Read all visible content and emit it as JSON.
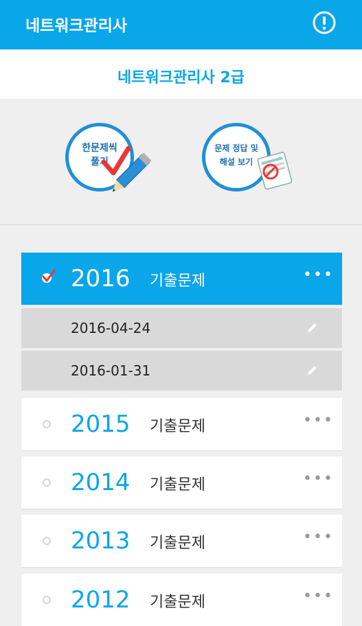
{
  "app_bar": {
    "title": "네트워크관리사"
  },
  "subheader": {
    "title": "네트워크관리사 2급"
  },
  "actions": {
    "study": {
      "text_line1": "한문제씩",
      "text_line2": "풀기"
    },
    "answers": {
      "text_line1": "문제 정답 및",
      "text_line2": "해설 보기"
    }
  },
  "years": [
    {
      "year": "2016",
      "label": "기출문제",
      "expanded": true,
      "dates": [
        "2016-04-24",
        "2016-01-31"
      ]
    },
    {
      "year": "2015",
      "label": "기출문제"
    },
    {
      "year": "2014",
      "label": "기출문제"
    },
    {
      "year": "2013",
      "label": "기출문제"
    },
    {
      "year": "2012",
      "label": "기출문제"
    }
  ],
  "more_glyph": "•••",
  "colors": {
    "primary": "#0aa6ea",
    "accent_red": "#e53935"
  }
}
